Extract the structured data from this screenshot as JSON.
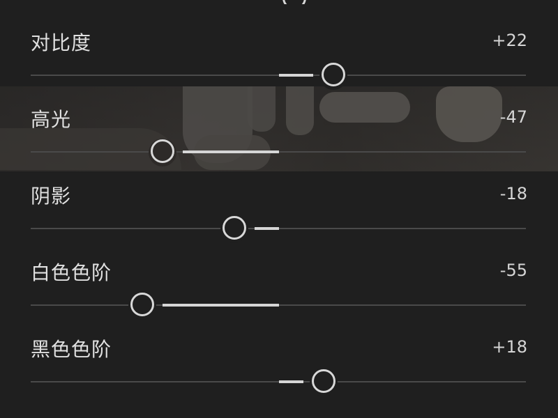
{
  "sliders": [
    {
      "key": "contrast",
      "label": "对比度",
      "value_text": "+22",
      "value": 22
    },
    {
      "key": "highlights",
      "label": "高光",
      "value_text": "-47",
      "value": -47
    },
    {
      "key": "shadows",
      "label": "阴影",
      "value_text": "-18",
      "value": -18
    },
    {
      "key": "whites",
      "label": "白色色阶",
      "value_text": "-55",
      "value": -55
    },
    {
      "key": "blacks",
      "label": "黑色色阶",
      "value_text": "+18",
      "value": 18
    }
  ],
  "range": [
    -100,
    100
  ],
  "colors": {
    "background": "#1f1f1f",
    "track": "#4a4a4a",
    "fill": "#d6d6d6",
    "thumb_ring": "#d8d8d8",
    "text": "#e0e0e0"
  }
}
